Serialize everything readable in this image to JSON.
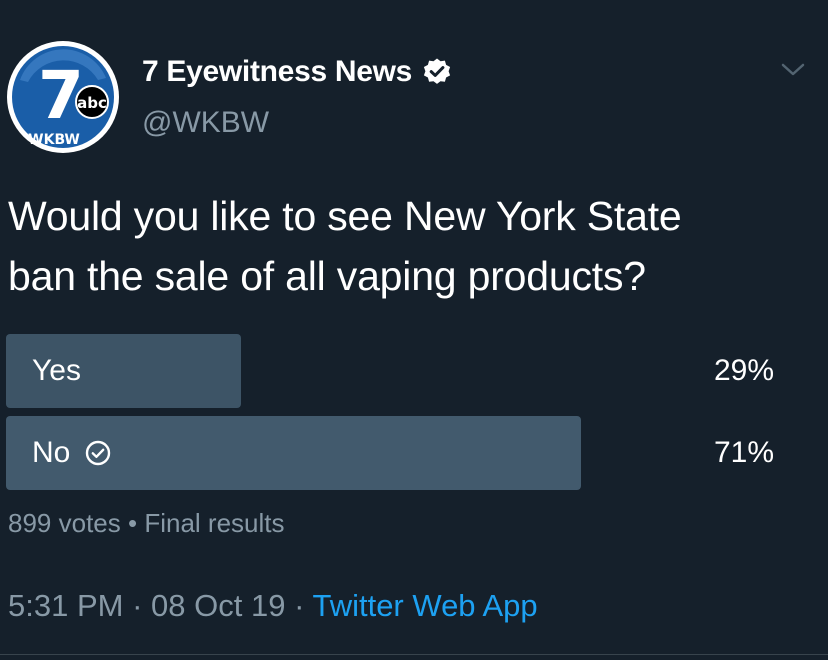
{
  "account": {
    "display_name": "7 Eyewitness News",
    "handle": "@WKBW",
    "avatar": {
      "logo_number": "7",
      "network": "abc",
      "callsign": "WKBW"
    },
    "verified": true
  },
  "tweet": {
    "text_line1": "Would you like to see New York State",
    "text_line2": "ban the sale of all vaping products?"
  },
  "poll": {
    "options": [
      {
        "label": "Yes",
        "percent_text": "29%",
        "fraction": 0.29,
        "winner": false
      },
      {
        "label": "No",
        "percent_text": "71%",
        "fraction": 0.71,
        "winner": true
      }
    ],
    "votes_text": "899 votes",
    "separator": "•",
    "status_text": "Final results"
  },
  "meta": {
    "time": "5:31 PM",
    "sep1": "·",
    "date": "08 Oct 19",
    "sep2": "·",
    "source": "Twitter Web App"
  },
  "colors": {
    "background": "#15202b",
    "secondary_text": "#8899a6",
    "link": "#1da1f2",
    "poll_bar": "#3d5466",
    "avatar_blue": "#1a5ea8"
  },
  "icons": {
    "verified": "verified-badge-icon",
    "menu": "chevron-down-icon",
    "winner": "check-circle-icon"
  }
}
